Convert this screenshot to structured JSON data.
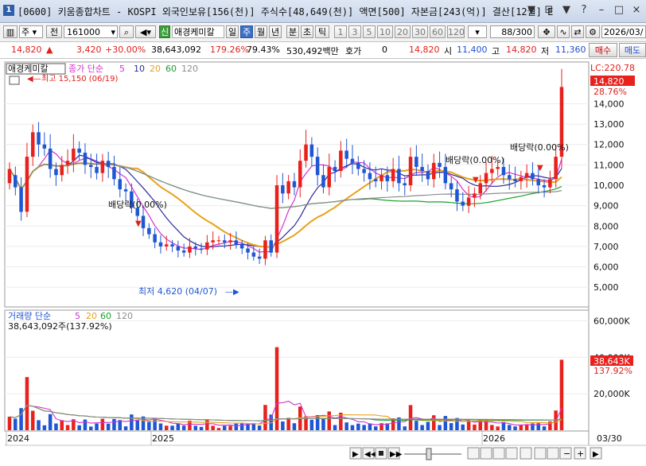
{
  "window": {
    "title": "[0600] 키움종합차트 - KOSPI 외국인보유[156(천)] 주식수[48,649(천)] 액면[500] 자본금[243(억)] 결산[12월] E",
    "controls": [
      "▼",
      "⊟",
      "▼",
      "?",
      "–",
      "□",
      "×"
    ]
  },
  "toolbar": {
    "period_type": "주",
    "adj_label": "전",
    "code": "161000",
    "stock_name": "애경케미칼",
    "credit_badge": "신",
    "period_buttons": [
      "일",
      "주",
      "월",
      "년",
      "분",
      "초",
      "틱"
    ],
    "selected_period": "주",
    "interval_buttons": [
      "1",
      "3",
      "5",
      "10",
      "20",
      "30",
      "60",
      "120"
    ],
    "count_value": "88",
    "count_total": "/300",
    "date_value": "2026/03/"
  },
  "infobar": {
    "price": "14,820",
    "change": "3,420",
    "change_pct": "+30.00%",
    "volume": "38,643,092",
    "volume_ratio": "179.26%",
    "turnover": "79.43%",
    "amount": "530,492백만",
    "quote_label": "호가",
    "quote_value": "0",
    "current": "14,820",
    "open_label": "시",
    "open": "11,400",
    "high_label": "고",
    "high": "14,820",
    "low_label": "저",
    "low": "11,360",
    "buy_label": "매수",
    "sell_label": "매도"
  },
  "price_panel": {
    "name_label": "애경케미칼",
    "legend_title": "종가 단순",
    "ma_periods": [
      "5",
      "10",
      "20",
      "60",
      "120"
    ],
    "lc_label": "LC:220.78",
    "current_tag": "14,820",
    "pct_tag": "28.76%",
    "high_marker": "최고 15,150 (06/19)",
    "low_marker": "최저 4,620 (04/07)",
    "dividend_labels": [
      "배당락(0.00%)",
      "배당락(0.00%)",
      "배당락(0.00%)"
    ],
    "y_ticks": [
      "14,000",
      "13,000",
      "12,000",
      "11,000",
      "10,000",
      "9,000",
      "8,000",
      "7,000",
      "6,000",
      "5,000"
    ]
  },
  "volume_panel": {
    "legend_title": "거래량 단순",
    "ma_periods": [
      "5",
      "20",
      "60",
      "120"
    ],
    "current_volume": "38,643,092주(137.92%)",
    "current_tag": "38,643K",
    "pct_tag": "137.92%",
    "y_ticks": [
      "60,000K",
      "40,000K",
      "20,000K"
    ]
  },
  "x_axis": {
    "labels": [
      "2024",
      "2025",
      "2026"
    ],
    "right_label": "03/30"
  },
  "colors": {
    "up": "#e8211d",
    "down": "#1f56d4",
    "ma5": "#d233d1",
    "ma10": "#2b2b9c",
    "ma20": "#e8a21a",
    "ma60": "#16a12a",
    "ma120": "#8c8c8c"
  },
  "chart_data": {
    "type": "candlestick",
    "series_price_weekly": {
      "open": [
        10100,
        10500,
        9900,
        8700,
        11400,
        12600,
        12000,
        11800,
        10800,
        10500,
        11000,
        11200,
        11800,
        11600,
        11000,
        10900,
        10600,
        11200,
        10900,
        10300,
        9800,
        9700,
        8900,
        8500,
        7900,
        7600,
        7200,
        7000,
        7100,
        7000,
        6800,
        6700,
        7000,
        6900,
        6850,
        7200,
        7300,
        7300,
        7200,
        7300,
        7100,
        6900,
        6700,
        6500,
        6400,
        7300,
        6700,
        10000,
        9600,
        10200,
        9900,
        11200,
        12000,
        11400,
        10500,
        9900,
        10900,
        10700,
        11700,
        11300,
        11100,
        10800,
        10600,
        10300,
        10200,
        10500,
        10200,
        10800,
        10100,
        10000,
        11400,
        10900,
        10700,
        10300,
        11100,
        10900,
        10100,
        9800,
        9200,
        9000,
        9400,
        9600,
        10100,
        10600,
        10800,
        10900,
        10500,
        10300,
        10200,
        10400,
        10600,
        10300,
        10000,
        9900,
        10300,
        11400
      ],
      "close": [
        10800,
        9900,
        8700,
        11400,
        12600,
        12000,
        11800,
        10800,
        10500,
        11000,
        11200,
        11800,
        11600,
        11000,
        10900,
        10600,
        11200,
        10900,
        10300,
        9800,
        9700,
        8900,
        8500,
        7900,
        7600,
        7200,
        7000,
        7100,
        7000,
        6800,
        6700,
        7000,
        6900,
        6850,
        7200,
        7300,
        7300,
        7200,
        7300,
        7100,
        6900,
        6700,
        6500,
        6400,
        7300,
        6700,
        10000,
        9600,
        10200,
        9900,
        11200,
        12000,
        11400,
        10500,
        9900,
        10900,
        10700,
        11700,
        11300,
        11100,
        10800,
        10600,
        10300,
        10200,
        10500,
        10200,
        10800,
        10100,
        10000,
        11400,
        10900,
        10700,
        10300,
        11100,
        10900,
        10100,
        9800,
        9200,
        9000,
        9400,
        9600,
        10100,
        10600,
        10800,
        10900,
        10500,
        10300,
        10200,
        10400,
        10600,
        10300,
        10000,
        9900,
        10300,
        11400,
        14820
      ]
    },
    "volume_ma_reference": {
      "latest": 38643092,
      "ratio_pct": 137.92
    },
    "ylim_price": [
      4500,
      15500
    ],
    "ylim_volume_K": [
      0,
      65000
    ]
  }
}
